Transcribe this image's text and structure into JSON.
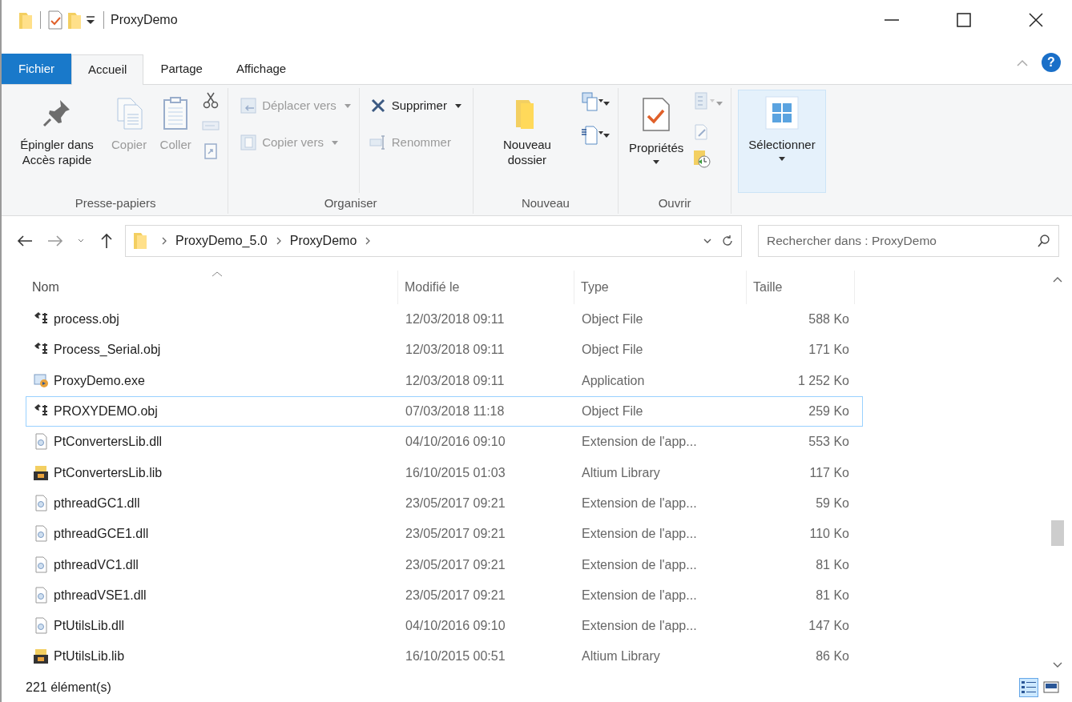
{
  "window": {
    "title": "ProxyDemo"
  },
  "tabs": [
    {
      "label": "Fichier",
      "kind": "file",
      "selected": false
    },
    {
      "label": "Accueil",
      "kind": "tab",
      "selected": true
    },
    {
      "label": "Partage",
      "kind": "tab",
      "selected": false
    },
    {
      "label": "Affichage",
      "kind": "tab",
      "selected": false
    }
  ],
  "help_label": "?",
  "ribbon": {
    "groups": [
      {
        "label": "Presse-papiers",
        "columns": [
          [
            {
              "kind": "large",
              "label": "Épingler dans Accès rapide",
              "disabled": false
            }
          ],
          [
            {
              "kind": "large",
              "label": "Copier",
              "disabled": true
            }
          ],
          [
            {
              "kind": "large",
              "label": "Coller",
              "disabled": true
            }
          ],
          [
            {
              "kind": "icon",
              "disabled": false
            },
            {
              "kind": "icon",
              "disabled": true
            },
            {
              "kind": "icon",
              "disabled": true
            }
          ]
        ]
      },
      {
        "label": "Organiser",
        "columns": [
          [
            {
              "kind": "small",
              "label": "Déplacer vers",
              "disabled": true,
              "dropdown": true
            },
            {
              "kind": "small",
              "label": "Copier vers",
              "disabled": true,
              "dropdown": true
            }
          ],
          [
            {
              "kind": "small",
              "label": "Supprimer",
              "disabled": false,
              "dropdown": true
            },
            {
              "kind": "small",
              "label": "Renommer",
              "disabled": true,
              "dropdown": false
            }
          ]
        ]
      },
      {
        "label": "Nouveau",
        "columns": [
          [
            {
              "kind": "large",
              "label": "Nouveau dossier",
              "disabled": false,
              "dropdown": false
            }
          ],
          [
            {
              "kind": "icon",
              "disabled": false,
              "dropdown": true
            },
            {
              "kind": "icon",
              "disabled": false,
              "dropdown": true
            }
          ]
        ]
      },
      {
        "label": "Ouvrir",
        "columns": [
          [
            {
              "kind": "large",
              "label": "Propriétés",
              "disabled": false,
              "dropdown": true
            }
          ],
          [
            {
              "kind": "icon",
              "disabled": true,
              "dropdown": true
            },
            {
              "kind": "icon",
              "disabled": true
            },
            {
              "kind": "icon",
              "disabled": false
            }
          ]
        ]
      },
      {
        "columns": [
          [
            {
              "kind": "large",
              "label": "Sélectionner",
              "disabled": false,
              "dropdown": true,
              "selected": true
            }
          ]
        ]
      }
    ]
  },
  "address": {
    "path": [
      "ProxyDemo_5.0",
      "ProxyDemo"
    ],
    "forward_disabled": true
  },
  "search": {
    "placeholder": "Rechercher dans : ProxyDemo"
  },
  "table": {
    "columns": [
      {
        "label": "Nom",
        "sorted": true
      },
      {
        "label": "Modifié le",
        "sorted": false
      },
      {
        "label": "Type",
        "sorted": false
      },
      {
        "label": "Taille",
        "sorted": false
      }
    ],
    "rows": [
      {
        "kind": "obj",
        "name": "process.obj",
        "modified": "12/03/2018 09:11",
        "type": "Object File",
        "size": "588 Ko",
        "focused": false
      },
      {
        "kind": "obj",
        "name": "Process_Serial.obj",
        "modified": "12/03/2018 09:11",
        "type": "Object File",
        "size": "171 Ko",
        "focused": false
      },
      {
        "kind": "exe",
        "name": "ProxyDemo.exe",
        "modified": "12/03/2018 09:11",
        "type": "Application",
        "size": "1 252 Ko",
        "focused": false
      },
      {
        "kind": "obj",
        "name": "PROXYDEMO.obj",
        "modified": "07/03/2018 11:18",
        "type": "Object File",
        "size": "259 Ko",
        "focused": true
      },
      {
        "kind": "dll",
        "name": "PtConvertersLib.dll",
        "modified": "04/10/2016 09:10",
        "type": "Extension de l'app...",
        "size": "553 Ko",
        "focused": false
      },
      {
        "kind": "lib",
        "name": "PtConvertersLib.lib",
        "modified": "16/10/2015 01:03",
        "type": "Altium Library",
        "size": "117 Ko",
        "focused": false
      },
      {
        "kind": "dll",
        "name": "pthreadGC1.dll",
        "modified": "23/05/2017 09:21",
        "type": "Extension de l'app...",
        "size": "59 Ko",
        "focused": false
      },
      {
        "kind": "dll",
        "name": "pthreadGCE1.dll",
        "modified": "23/05/2017 09:21",
        "type": "Extension de l'app...",
        "size": "110 Ko",
        "focused": false
      },
      {
        "kind": "dll",
        "name": "pthreadVC1.dll",
        "modified": "23/05/2017 09:21",
        "type": "Extension de l'app...",
        "size": "81 Ko",
        "focused": false
      },
      {
        "kind": "dll",
        "name": "pthreadVSE1.dll",
        "modified": "23/05/2017 09:21",
        "type": "Extension de l'app...",
        "size": "81 Ko",
        "focused": false
      },
      {
        "kind": "dll",
        "name": "PtUtilsLib.dll",
        "modified": "04/10/2016 09:10",
        "type": "Extension de l'app...",
        "size": "147 Ko",
        "focused": false
      },
      {
        "kind": "lib",
        "name": "PtUtilsLib.lib",
        "modified": "16/10/2015 00:51",
        "type": "Altium Library",
        "size": "86 Ko",
        "focused": false
      }
    ]
  },
  "status_bar": {
    "count": "221 élément(s)",
    "views": [
      {
        "kind": "details",
        "selected": true
      },
      {
        "kind": "large",
        "selected": false
      }
    ]
  }
}
